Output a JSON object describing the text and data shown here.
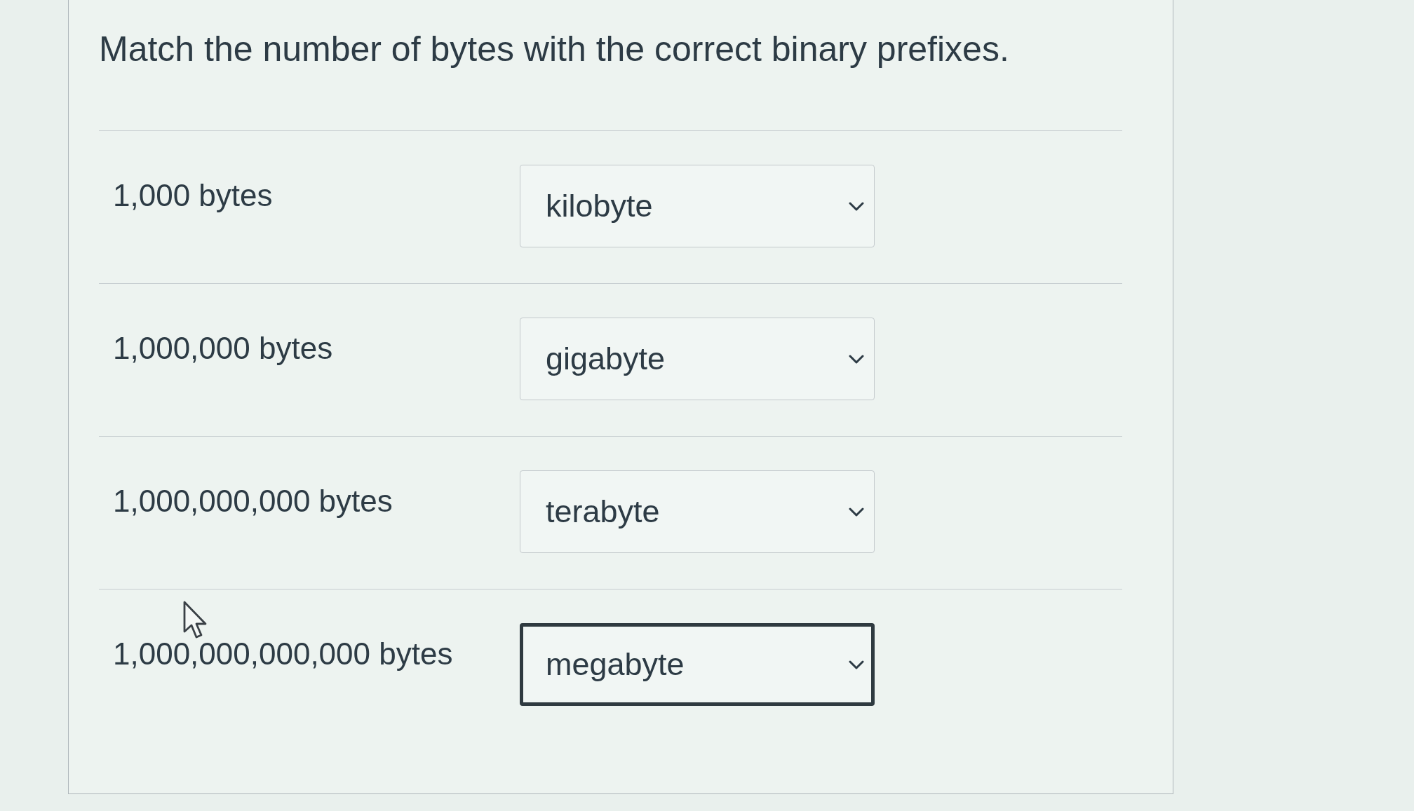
{
  "question": {
    "text": "Match the number of bytes with the correct binary prefixes."
  },
  "pairs": [
    {
      "prompt": "1,000 bytes",
      "answer": "kilobyte",
      "focused": false
    },
    {
      "prompt": "1,000,000 bytes",
      "answer": "gigabyte",
      "focused": false
    },
    {
      "prompt": "1,000,000,000 bytes",
      "answer": "terabyte",
      "focused": false
    },
    {
      "prompt": "1,000,000,000,000 bytes",
      "answer": "megabyte",
      "focused": true
    }
  ]
}
